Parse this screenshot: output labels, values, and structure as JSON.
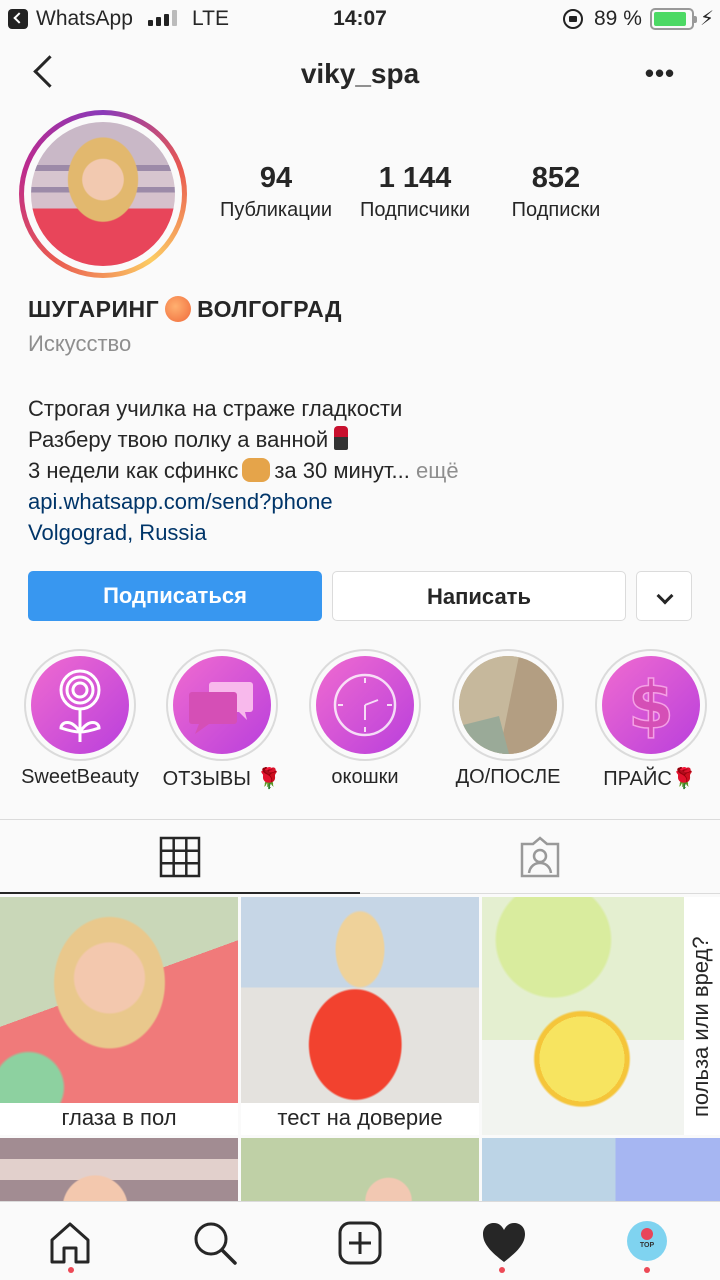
{
  "status_bar": {
    "app": "WhatsApp",
    "network": "LTE",
    "time": "14:07",
    "battery": "89 %",
    "battery_level": 0.89,
    "battery_color": "#4cd964"
  },
  "header": {
    "title": "viky_spa",
    "back_icon": "chevron-left-icon",
    "more_icon": "more-dots-icon",
    "more_label": "•••"
  },
  "profile": {
    "stats": [
      {
        "value": "94",
        "label": "Публикации"
      },
      {
        "value": "1 144",
        "label": "Подписчики"
      },
      {
        "value": "852",
        "label": "Подписки"
      }
    ],
    "name_part1": "ШУГАРИНГ",
    "name_part2": "ВОЛГОГРАД",
    "category": "Искусство",
    "bio": {
      "line1": "Строгая училка на страже гладкости",
      "line2": "Разберу твою полку а ванной",
      "line3": "3 недели как сфинкс",
      "line3_end": "за 30 минут...",
      "more": "ещё",
      "link": "api.whatsapp.com/send?phone",
      "location": "Volgograd, Russia"
    }
  },
  "actions": {
    "follow": "Подписаться",
    "message": "Написать",
    "follow_color": "#3897f0"
  },
  "highlights": [
    {
      "label": "SweetBeauty",
      "icon": "lollipop-flower-icon"
    },
    {
      "label": "ОТЗЫВЫ 🌹",
      "icon": "chat-bubbles-icon"
    },
    {
      "label": "окошки",
      "icon": "clock-icon"
    },
    {
      "label": "ДО/ПОСЛЕ",
      "icon": "before-after-photo"
    },
    {
      "label": "ПРАЙС🌹",
      "icon": "dollar-icon"
    }
  ],
  "tabs": [
    {
      "name": "grid",
      "icon": "grid-icon",
      "active": true
    },
    {
      "name": "tagged",
      "icon": "tagged-person-icon",
      "active": false
    }
  ],
  "posts": [
    {
      "caption": "глаза в пол"
    },
    {
      "caption": "тест на доверие"
    },
    {
      "caption": "польза или вред?"
    }
  ],
  "bottom_nav": [
    {
      "icon": "home-icon",
      "dot": true
    },
    {
      "icon": "search-icon",
      "dot": false
    },
    {
      "icon": "add-post-icon",
      "dot": false
    },
    {
      "icon": "heart-icon",
      "dot": true
    },
    {
      "icon": "profile-avatar",
      "dot": true,
      "avatar_text": "TOP"
    }
  ],
  "colors": {
    "notification_dot": "#ed4956",
    "link": "#003569",
    "muted": "#8e8e8e"
  }
}
